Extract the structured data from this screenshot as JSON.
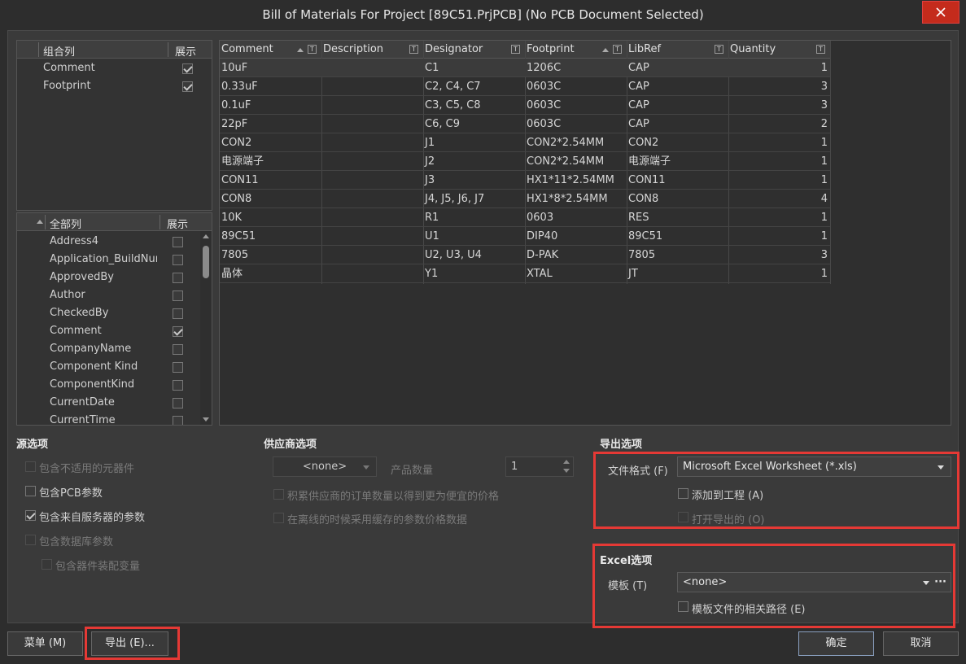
{
  "window": {
    "title": "Bill of Materials For Project [89C51.PrjPCB] (No PCB Document Selected)"
  },
  "group_panel": {
    "col_name": "组合列",
    "col_show": "展示",
    "items": [
      {
        "label": "Comment",
        "checked": true
      },
      {
        "label": "Footprint",
        "checked": true
      }
    ]
  },
  "all_panel": {
    "col_name": "全部列",
    "col_show": "展示",
    "items": [
      {
        "label": "Address4",
        "checked": false
      },
      {
        "label": "Application_BuildNum",
        "checked": false
      },
      {
        "label": "ApprovedBy",
        "checked": false
      },
      {
        "label": "Author",
        "checked": false
      },
      {
        "label": "CheckedBy",
        "checked": false
      },
      {
        "label": "Comment",
        "checked": true
      },
      {
        "label": "CompanyName",
        "checked": false
      },
      {
        "label": "Component Kind",
        "checked": false
      },
      {
        "label": "ComponentKind",
        "checked": false
      },
      {
        "label": "CurrentDate",
        "checked": false
      },
      {
        "label": "CurrentTime",
        "checked": false
      }
    ]
  },
  "grid": {
    "columns": [
      "Comment",
      "Description",
      "Designator",
      "Footprint",
      "LibRef",
      "Quantity"
    ],
    "rows": [
      [
        "10uF",
        "",
        "C1",
        "1206C",
        "CAP",
        "1"
      ],
      [
        "0.33uF",
        "",
        "C2, C4, C7",
        "0603C",
        "CAP",
        "3"
      ],
      [
        "0.1uF",
        "",
        "C3, C5, C8",
        "0603C",
        "CAP",
        "3"
      ],
      [
        "22pF",
        "",
        "C6, C9",
        "0603C",
        "CAP",
        "2"
      ],
      [
        "CON2",
        "",
        "J1",
        "CON2*2.54MM",
        "CON2",
        "1"
      ],
      [
        "电源端子",
        "",
        "J2",
        "CON2*2.54MM",
        "电源端子",
        "1"
      ],
      [
        "CON11",
        "",
        "J3",
        "HX1*11*2.54MM",
        "CON11",
        "1"
      ],
      [
        "CON8",
        "",
        "J4, J5, J6, J7",
        "HX1*8*2.54MM",
        "CON8",
        "4"
      ],
      [
        "10K",
        "",
        "R1",
        "0603",
        "RES",
        "1"
      ],
      [
        "89C51",
        "",
        "U1",
        "DIP40",
        "89C51",
        "1"
      ],
      [
        "7805",
        "",
        "U2, U3, U4",
        "D-PAK",
        "7805",
        "3"
      ],
      [
        "晶体",
        "",
        "Y1",
        "XTAL",
        "JT",
        "1"
      ]
    ]
  },
  "source": {
    "title": "源选项",
    "opt1": "包含不适用的元器件",
    "opt2": "包含PCB参数",
    "opt3": "包含来自服务器的参数",
    "opt4": "包含数据库参数",
    "opt5": "包含器件装配变量"
  },
  "supplier": {
    "title": "供应商选项",
    "combo_value": "<none>",
    "qty_label": "产品数量",
    "qty_value": "1",
    "opt1": "积累供应商的订单数量以得到更为便宜的价格",
    "opt2": "在离线的时候采用缓存的参数价格数据"
  },
  "export": {
    "title": "导出选项",
    "format_label": "文件格式 (F)",
    "format_value": "Microsoft Excel Worksheet (*.xls)",
    "add_to_project": "添加到工程 (A)",
    "open_exported": "打开导出的 (O)"
  },
  "excel": {
    "title": "Excel选项",
    "template_label": "模板 (T)",
    "template_value": "<none>",
    "template_more": "···",
    "relative_path": "模板文件的相关路径 (E)"
  },
  "buttons": {
    "menu": "菜单 (M)",
    "export": "导出 (E)...",
    "ok": "确定",
    "cancel": "取消"
  },
  "colors": {
    "accent_red": "#e53935",
    "close_red": "#c42b1c"
  }
}
